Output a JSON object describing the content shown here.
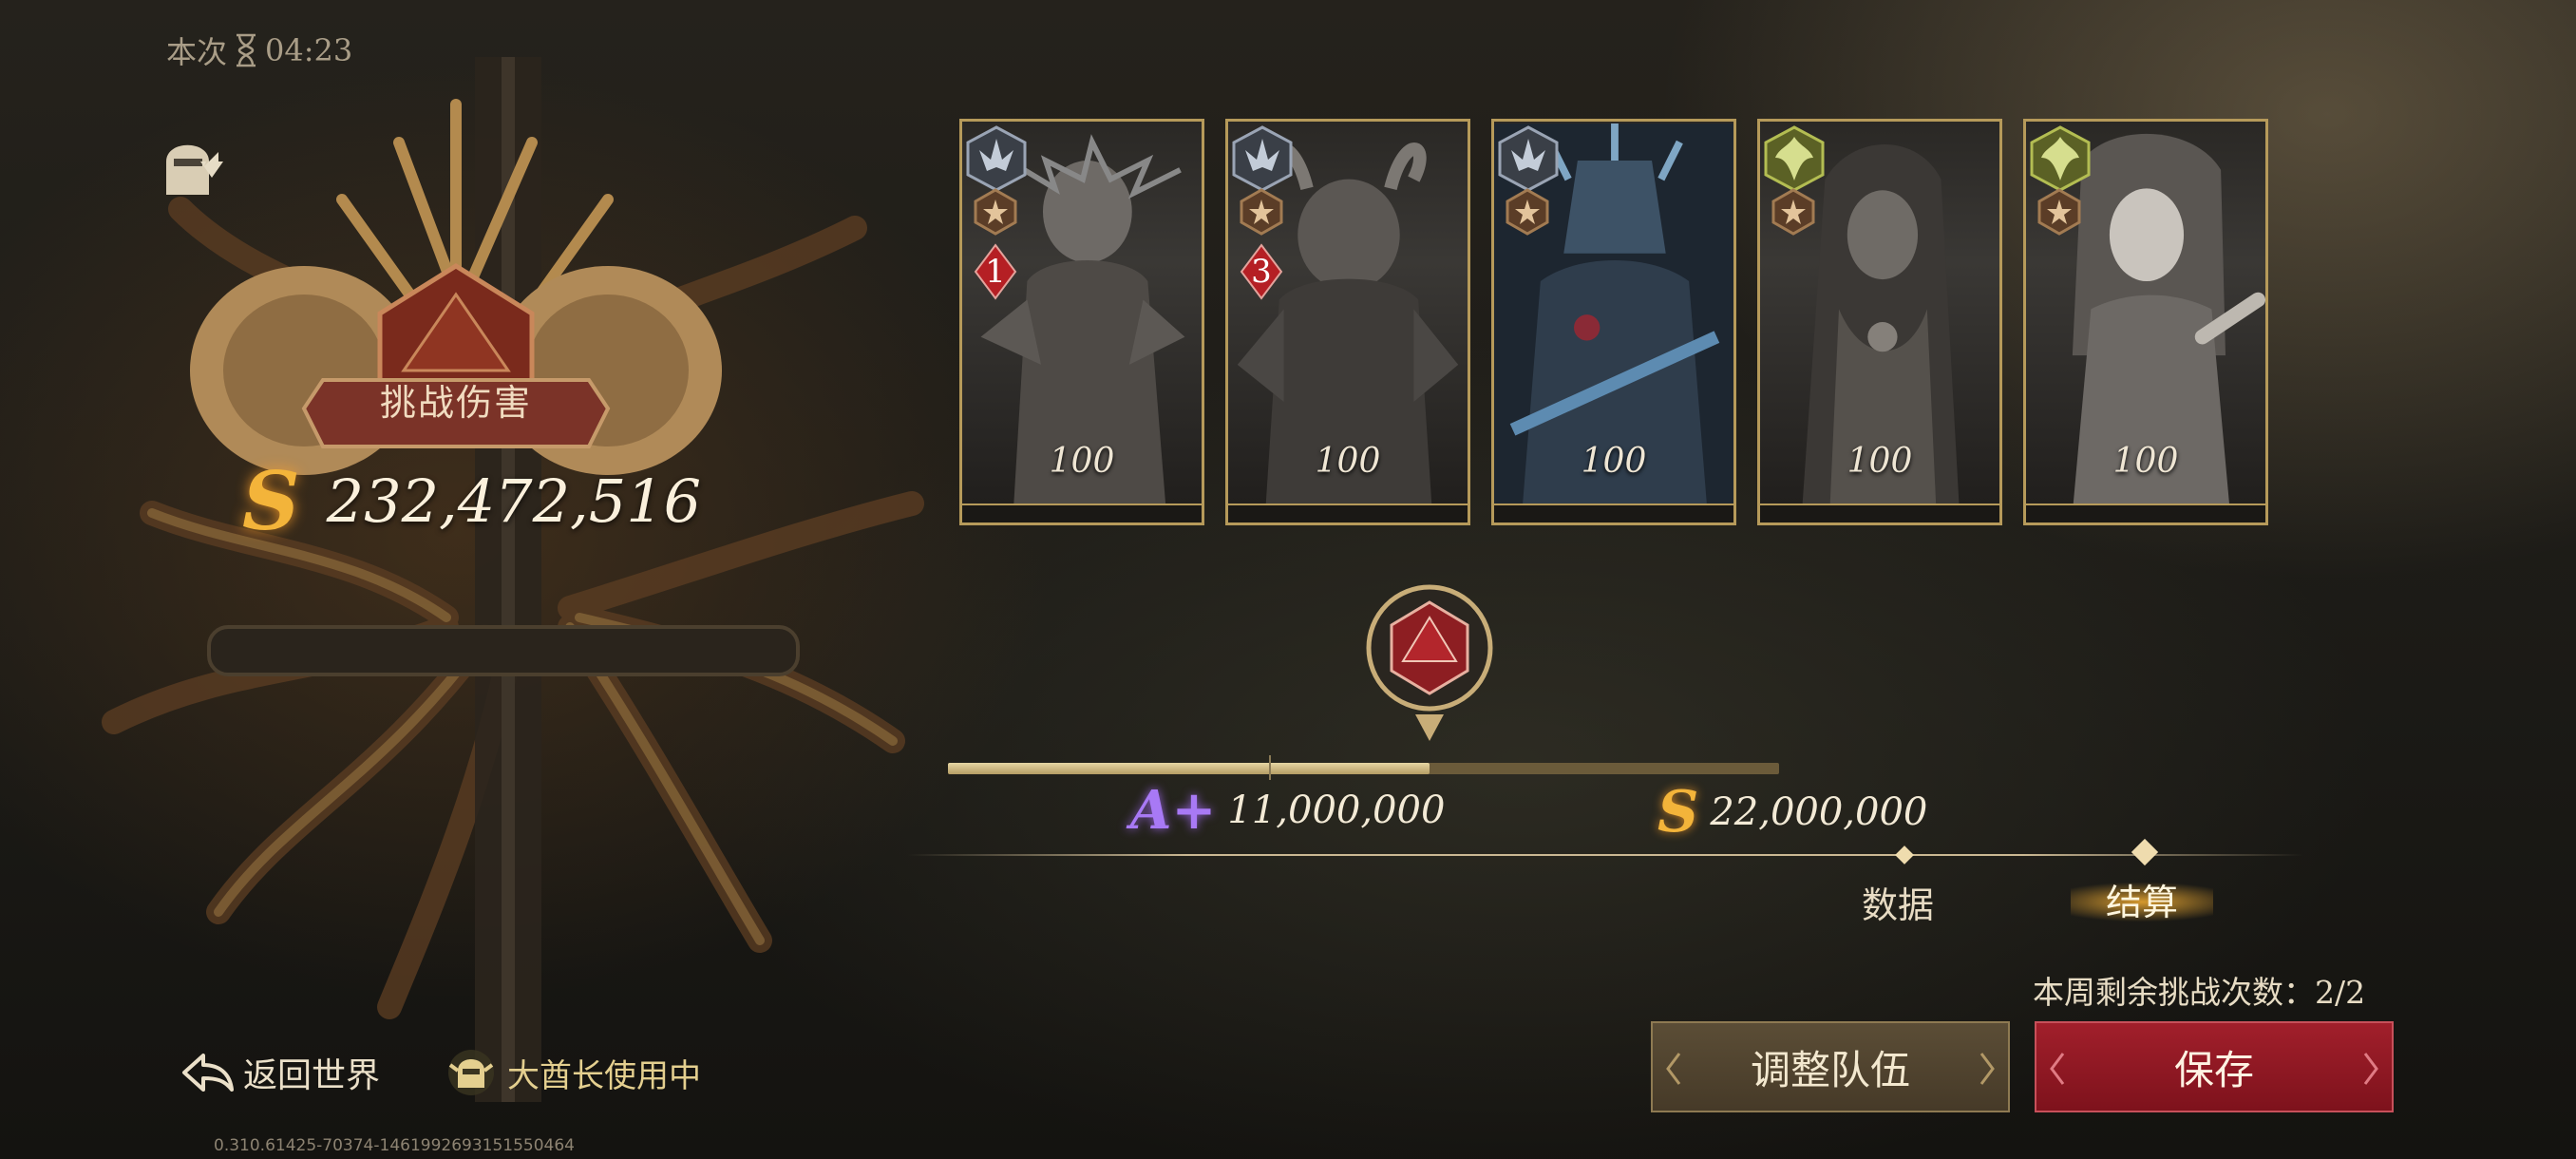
{
  "session": {
    "label": "本次",
    "timer": "04:23"
  },
  "challenge": {
    "title": "挑战伤害",
    "grade": "S",
    "damage": "232,472,516"
  },
  "heroes": [
    {
      "level": "100",
      "rank": "1",
      "class_color": "#9aa4b4"
    },
    {
      "level": "100",
      "rank": "3",
      "class_color": "#9aa4b4"
    },
    {
      "level": "100",
      "rank": "",
      "class_color": "#9aa4b4"
    },
    {
      "level": "100",
      "rank": "",
      "class_color": "#8f9a3a"
    },
    {
      "level": "100",
      "rank": "",
      "class_color": "#8f9a3a"
    }
  ],
  "progress": {
    "fraction": 0.58,
    "thresholds": [
      {
        "grade": "A+",
        "value": "11,000,000"
      },
      {
        "grade": "S",
        "value": "22,000,000"
      }
    ]
  },
  "tabs": {
    "data": "数据",
    "settle": "结算"
  },
  "remaining": "本周剩余挑战次数：2/2",
  "buttons": {
    "adjust": "调整队伍",
    "save": "保存"
  },
  "nav": {
    "back": "返回世界",
    "chief": "大酋长使用中"
  },
  "version": "0.310.61425-70374-1461992693151550464",
  "icons": [
    "hourglass-icon",
    "helmet-upgrade-icon",
    "dice-icon",
    "back-arrow-icon",
    "chief-helmet-icon",
    "class-crest-icon",
    "star-badge-icon",
    "rank-diamond-icon"
  ],
  "colors": {
    "gold": "#f3b43a",
    "purple": "#a879f5",
    "save_red": "#a11f2b",
    "card_border": "#b69a5a"
  }
}
